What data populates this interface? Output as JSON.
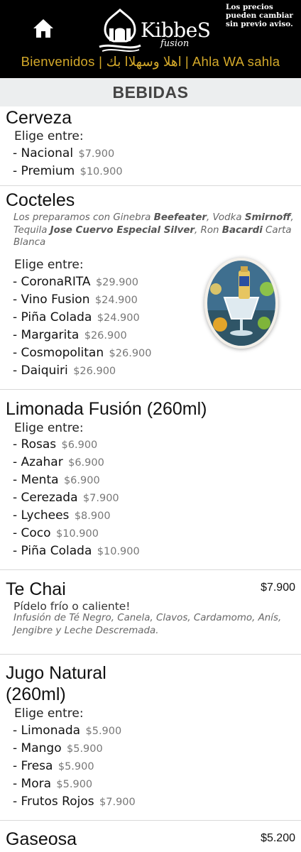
{
  "header": {
    "home_icon": "home-icon",
    "logo_name": "KibbeS",
    "logo_sub": "fusion",
    "notice": "Los precios pueden cambiar sin previo aviso.",
    "welcome": "Bienvenidos | اهلا وسهلاا بك | Ahla WA sahla",
    "accent_color": "#d4a92a"
  },
  "category": {
    "title": "BEBIDAS"
  },
  "sections": {
    "cerveza": {
      "title": "Cerveza",
      "pick": "Elige entre:",
      "items": [
        {
          "label": "- Nacional",
          "price": "$7.900"
        },
        {
          "label": "- Premium",
          "price": "$10.900"
        }
      ]
    },
    "cocteles": {
      "title": "Cocteles",
      "desc_1": "Los preparamos con Ginebra ",
      "desc_2": "Beefeater",
      "desc_3": ", Vodka ",
      "desc_4": "Smirnoff",
      "desc_5": ", Tequila ",
      "desc_6": "Jose Cuervo Especial Silver",
      "desc_7": ", Ron ",
      "desc_8": "Bacardi",
      "desc_9": " Carta Blanca",
      "pick": "Elige entre:",
      "items": [
        {
          "label": "- CoronaRITA",
          "price": "$29.900"
        },
        {
          "label": "- Vino Fusion",
          "price": "$24.900"
        },
        {
          "label": "- Piña Colada",
          "price": "$24.900"
        },
        {
          "label": "- Margarita",
          "price": "$26.900"
        },
        {
          "label": "- Cosmopolitan",
          "price": "$26.900"
        },
        {
          "label": "- Daiquiri",
          "price": "$26.900"
        }
      ]
    },
    "limonada": {
      "title": "Limonada Fusión (260ml)",
      "pick": "Elige entre:",
      "items": [
        {
          "label": "- Rosas",
          "price": "$6.900"
        },
        {
          "label": "- Azahar",
          "price": "$6.900"
        },
        {
          "label": "- Menta",
          "price": "$6.900"
        },
        {
          "label": "- Cerezada",
          "price": "$7.900"
        },
        {
          "label": "- Lychees",
          "price": "$8.900"
        },
        {
          "label": "- Coco",
          "price": "$10.900"
        },
        {
          "label": "- Piña Colada",
          "price": "$10.900"
        }
      ]
    },
    "te_chai": {
      "title": "Te Chai",
      "price": "$7.900",
      "note": "Pídelo frío o caliente!",
      "desc": "Infusión de Té Negro, Canela, Clavos, Cardamomo, Anís, Jengibre y Leche Descremada."
    },
    "jugo": {
      "title_1": "Jugo Natural",
      "title_2": "(260ml)",
      "pick": "Elige entre:",
      "items": [
        {
          "label": "- Limonada",
          "price": "$5.900"
        },
        {
          "label": "- Mango",
          "price": "$5.900"
        },
        {
          "label": "- Fresa",
          "price": "$5.900"
        },
        {
          "label": "- Mora",
          "price": "$5.900"
        },
        {
          "label": "- Frutos Rojos",
          "price": "$7.900"
        }
      ]
    },
    "gaseosa": {
      "title": "Gaseosa",
      "price": "$5.200"
    }
  }
}
